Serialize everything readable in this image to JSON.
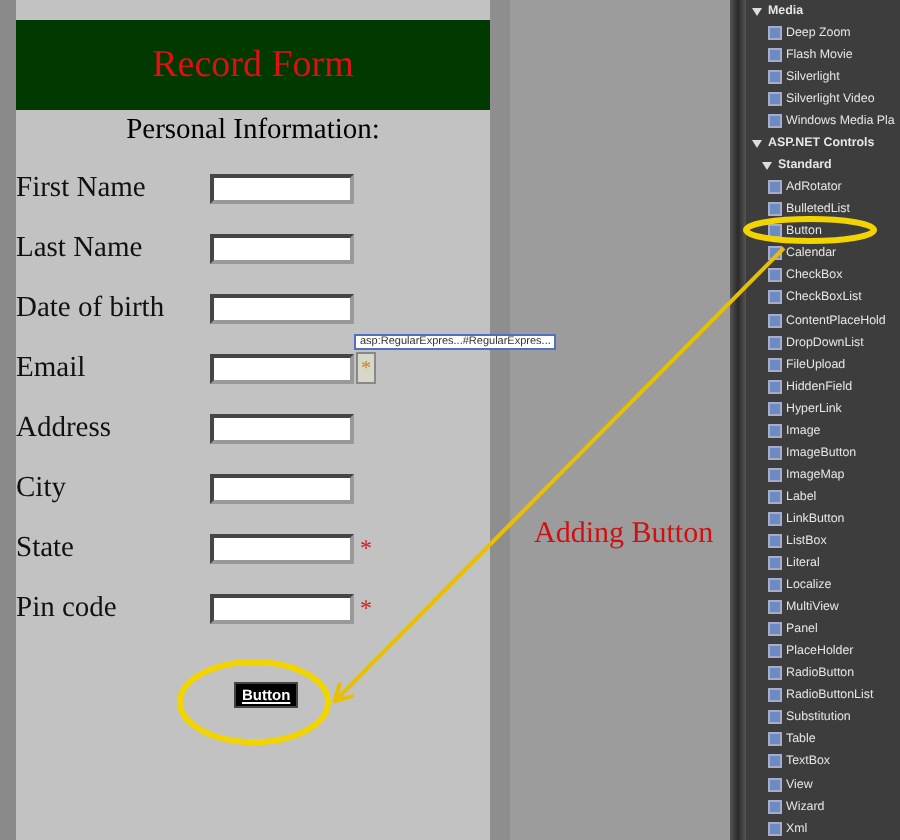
{
  "form": {
    "title": "Record Form",
    "section": "Personal Information:",
    "fields": [
      {
        "label": "First Name",
        "kind": "plain"
      },
      {
        "label": "Last Name",
        "kind": "plain"
      },
      {
        "label": "Date of birth",
        "kind": "plain"
      },
      {
        "label": "Email",
        "kind": "regex",
        "marker": "*",
        "tooltip": "asp:RegularExpres...#RegularExpres..."
      },
      {
        "label": "Address",
        "kind": "plain"
      },
      {
        "label": "City",
        "kind": "plain"
      },
      {
        "label": "State",
        "kind": "required",
        "marker": "*"
      },
      {
        "label": "Pin code",
        "kind": "required",
        "marker": "*"
      }
    ],
    "button": "Button"
  },
  "annotation": "Adding Button",
  "toolbox": {
    "groups": [
      {
        "label": "Media",
        "expanded": true,
        "children": [
          {
            "label": "Deep Zoom"
          },
          {
            "label": "Flash Movie"
          },
          {
            "label": "Silverlight"
          },
          {
            "label": "Silverlight Video"
          },
          {
            "label": "Windows Media Pla"
          }
        ]
      },
      {
        "label": "ASP.NET Controls",
        "expanded": true,
        "children": [
          {
            "label": "Standard",
            "expanded": true,
            "children": [
              {
                "label": "AdRotator"
              },
              {
                "label": "BulletedList"
              },
              {
                "label": "Button"
              },
              {
                "label": "Calendar"
              },
              {
                "label": "CheckBox"
              },
              {
                "label": "CheckBoxList"
              },
              {
                "label": "ContentPlaceHold"
              },
              {
                "label": "DropDownList"
              },
              {
                "label": "FileUpload"
              },
              {
                "label": "HiddenField"
              },
              {
                "label": "HyperLink"
              },
              {
                "label": "Image"
              },
              {
                "label": "ImageButton"
              },
              {
                "label": "ImageMap"
              },
              {
                "label": "Label"
              },
              {
                "label": "LinkButton"
              },
              {
                "label": "ListBox"
              },
              {
                "label": "Literal"
              },
              {
                "label": "Localize"
              },
              {
                "label": "MultiView"
              },
              {
                "label": "Panel"
              },
              {
                "label": "PlaceHolder"
              },
              {
                "label": "RadioButton"
              },
              {
                "label": "RadioButtonList"
              },
              {
                "label": "Substitution"
              },
              {
                "label": "Table"
              },
              {
                "label": "TextBox"
              },
              {
                "label": "View"
              },
              {
                "label": "Wizard"
              },
              {
                "label": "Xml"
              }
            ]
          }
        ]
      }
    ]
  }
}
